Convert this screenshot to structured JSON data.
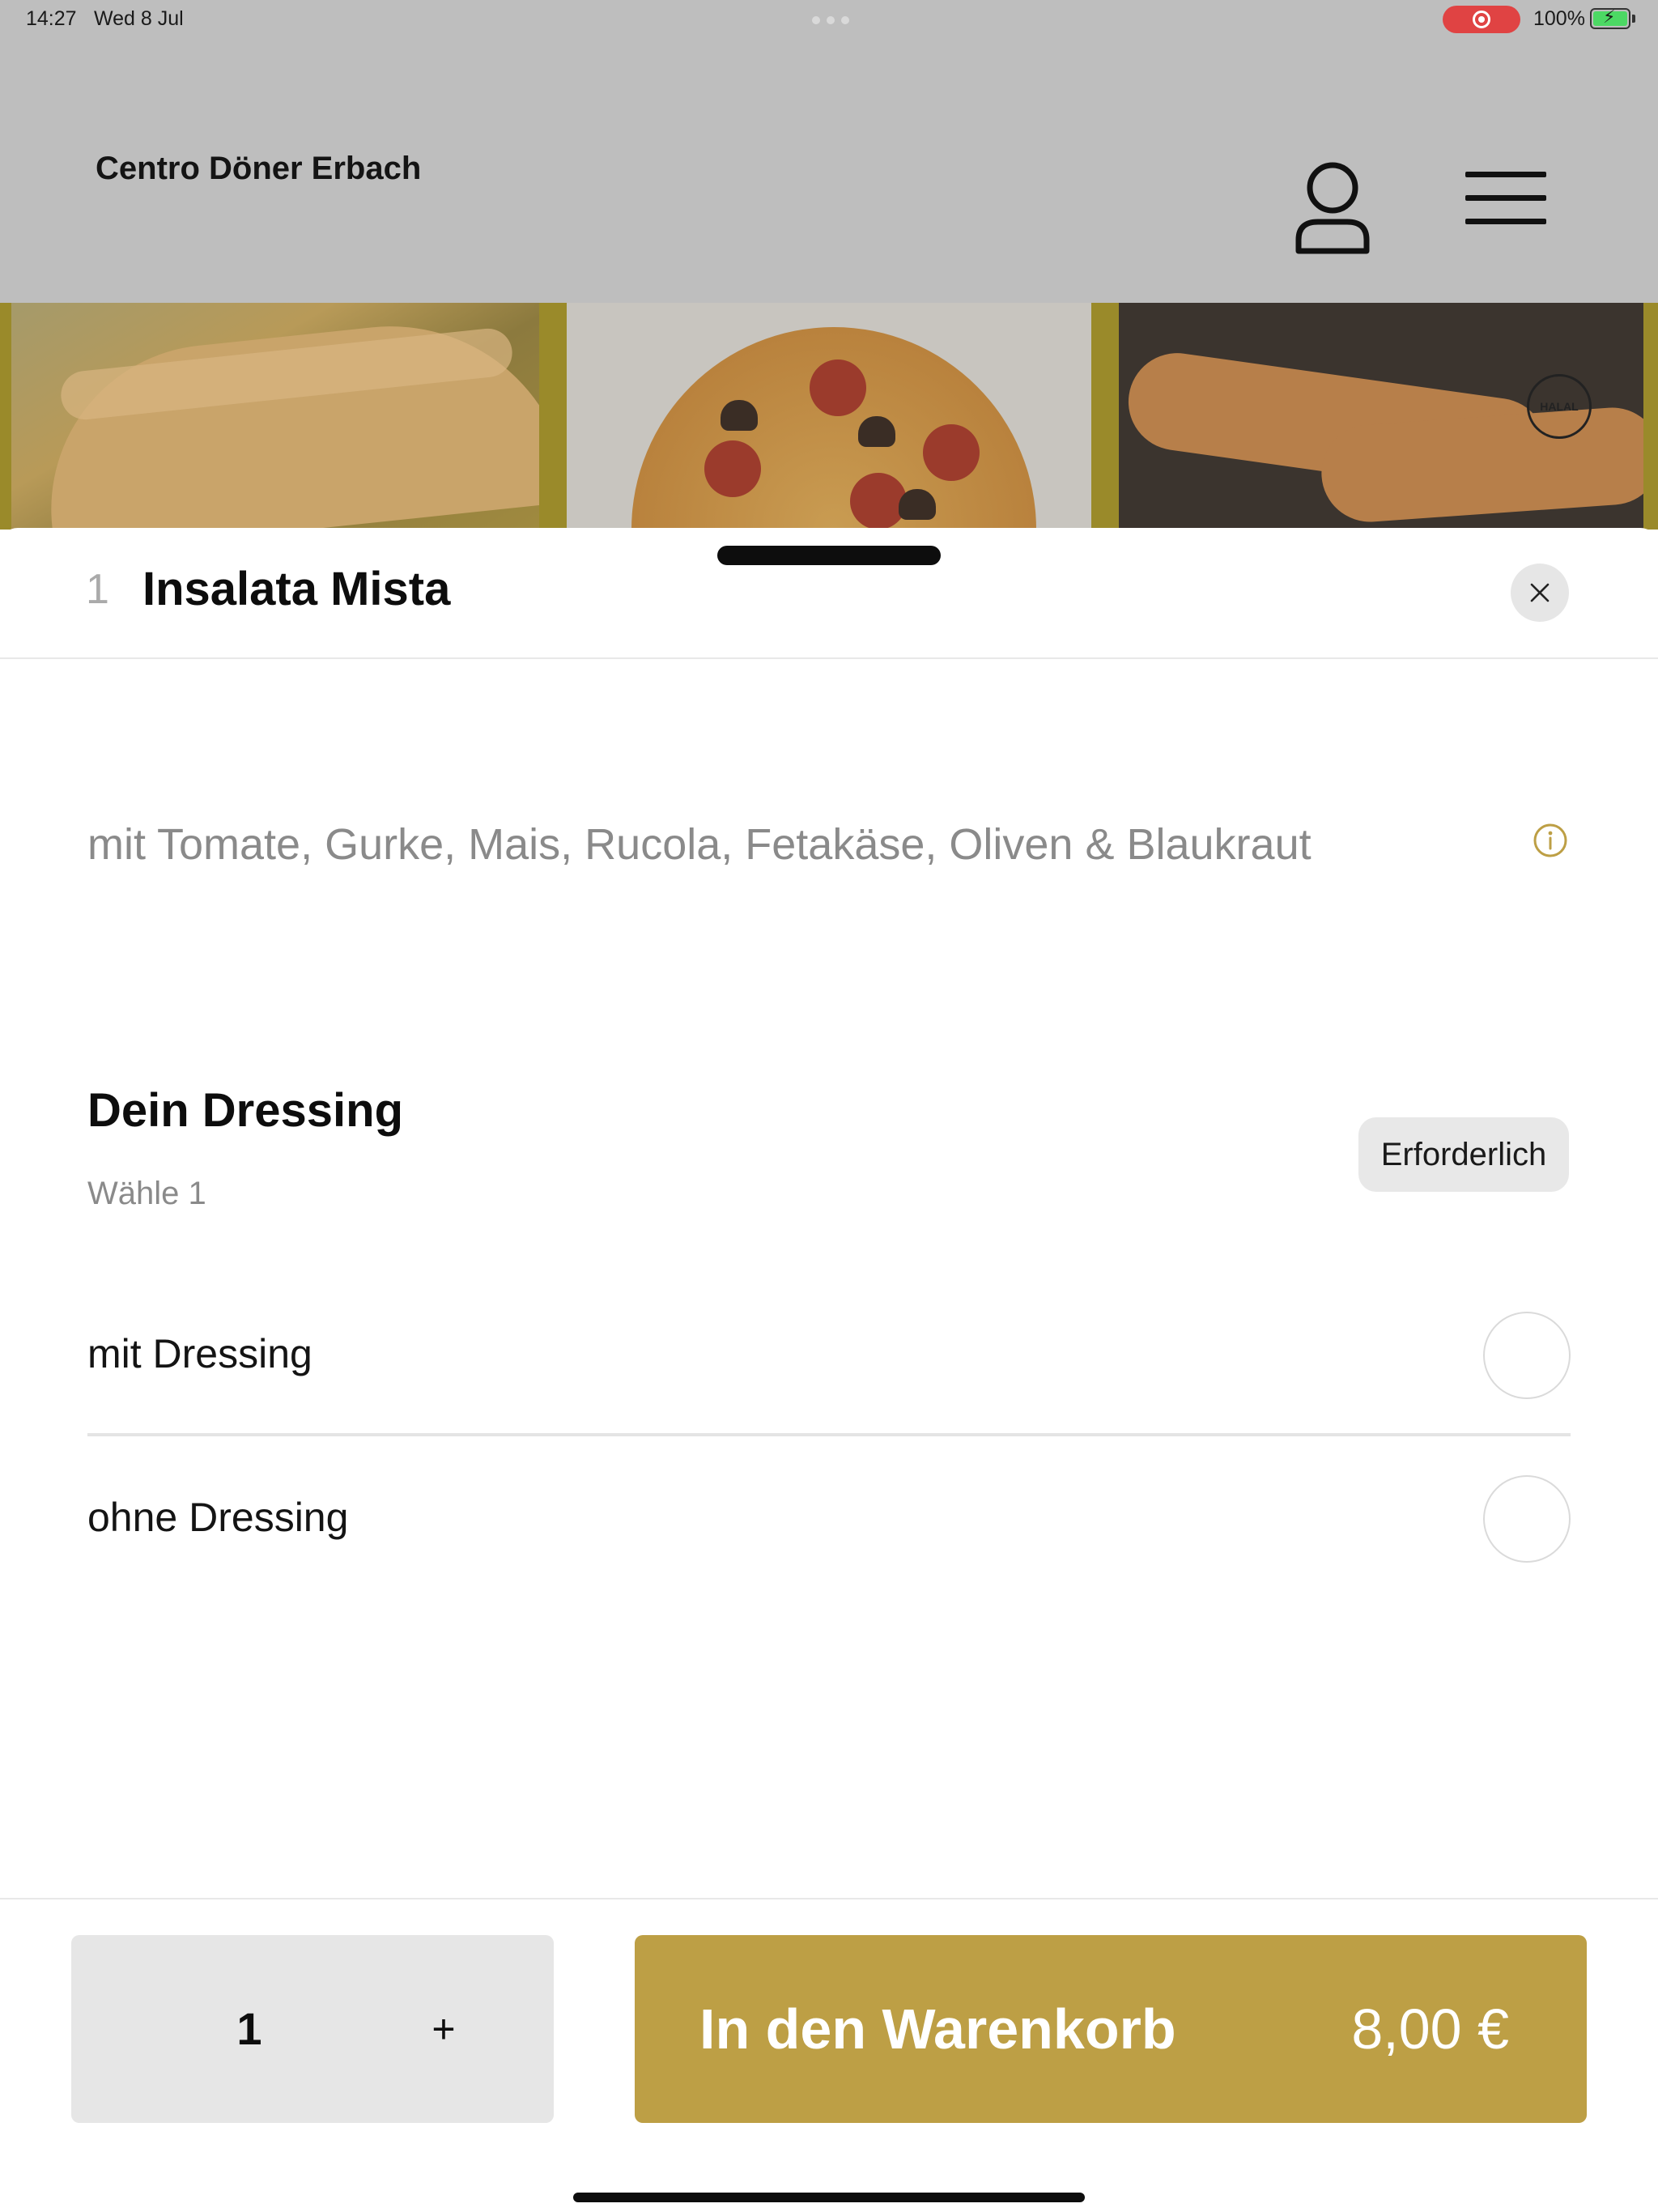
{
  "status_bar": {
    "time": "14:27",
    "date": "Wed 8 Jul",
    "battery_percent": "100%"
  },
  "header": {
    "restaurant_name": "Centro Döner Erbach",
    "profile_icon": "person-icon",
    "menu_icon": "hamburger-menu-icon"
  },
  "banner": {
    "tiles": [
      "sandwich-image",
      "pizza-image",
      "pide-image"
    ],
    "halal_badge": "HALAL"
  },
  "sheet": {
    "item_number": "1",
    "item_title": "Insalata Mista",
    "close_icon": "close-icon",
    "description": "mit Tomate, Gurke, Mais, Rucola, Fetakäse, Oliven & Blaukraut",
    "info_icon": "info-icon",
    "option_group": {
      "title": "Dein Dressing",
      "subtitle": "Wähle 1",
      "required_label": "Erforderlich",
      "options": [
        {
          "label": "mit Dressing",
          "selected": false
        },
        {
          "label": "ohne Dressing",
          "selected": false
        }
      ]
    }
  },
  "footer": {
    "quantity": "1",
    "plus_label": "+",
    "add_to_cart_label": "In den Warenkorb",
    "price": "8,00 €"
  },
  "colors": {
    "accent": "#bd9f45",
    "dim_overlay": "#bebebe",
    "record_red": "#e04343"
  }
}
